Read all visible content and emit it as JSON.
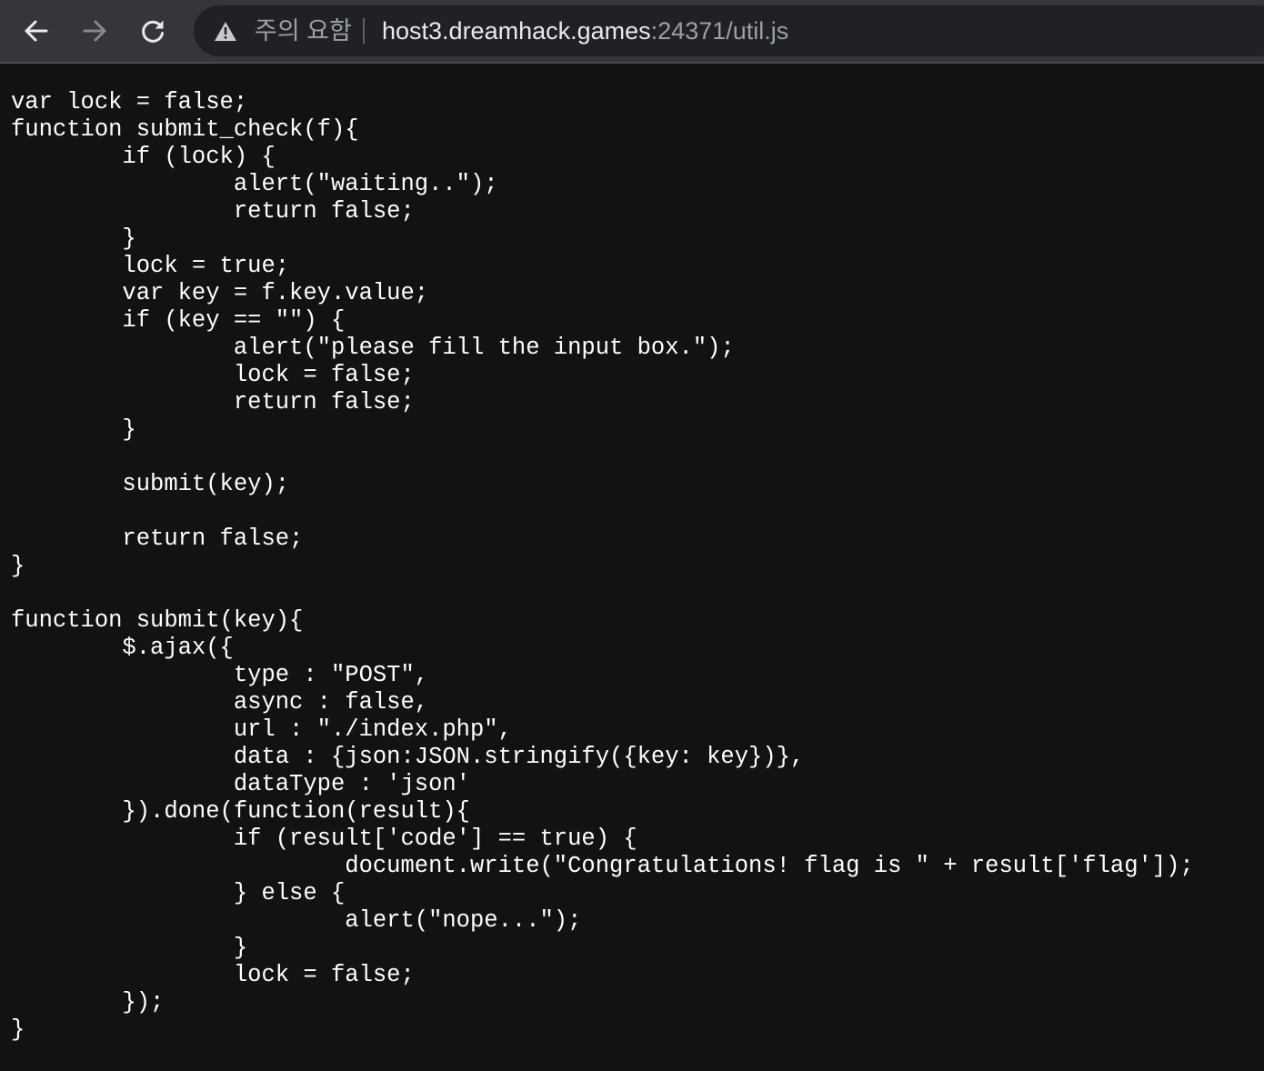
{
  "browser": {
    "security_label": "주의 요함",
    "url_host": "host3.dreamhack.games",
    "url_rest": ":24371/util.js",
    "icons": {
      "back": "arrow-left",
      "forward": "arrow-right",
      "reload": "circular-arrow",
      "security": "warning-triangle"
    }
  },
  "page": {
    "code": "var lock = false;\nfunction submit_check(f){\n\tif (lock) {\n\t\talert(\"waiting..\");\n\t\treturn false;\n\t}\n\tlock = true;\n\tvar key = f.key.value;\n\tif (key == \"\") {\n\t\talert(\"please fill the input box.\");\n\t\tlock = false;\n\t\treturn false;\n\t}\n\n\tsubmit(key);\n\n\treturn false;\n}\n\nfunction submit(key){\n\t$.ajax({\n\t\ttype : \"POST\",\n\t\tasync : false,\n\t\turl : \"./index.php\",\n\t\tdata : {json:JSON.stringify({key: key})},\n\t\tdataType : 'json'\n\t}).done(function(result){\n\t\tif (result['code'] == true) {\n\t\t\tdocument.write(\"Congratulations! flag is \" + result['flag']);\n\t\t} else {\n\t\t\talert(\"nope...\");\n\t\t}\n\t\tlock = false;\n\t});\n}"
  }
}
